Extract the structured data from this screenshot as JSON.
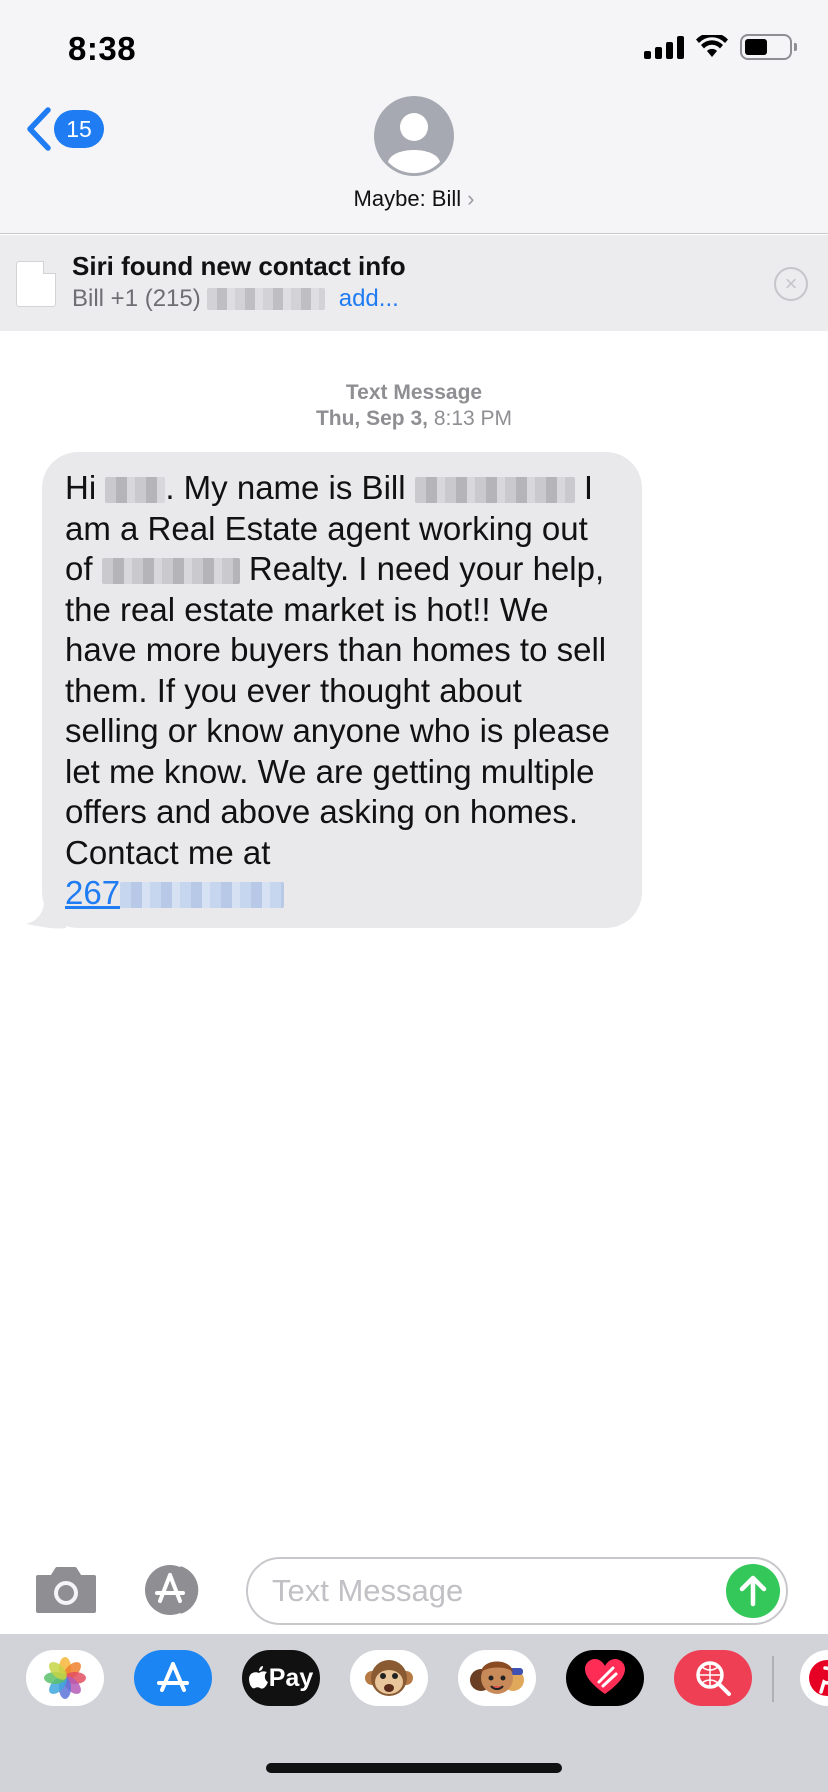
{
  "status_bar": {
    "time": "8:38"
  },
  "nav": {
    "back_badge": "15",
    "contact_name": "Maybe: Bill",
    "contact_chevron": "›"
  },
  "siri_banner": {
    "title": "Siri found new contact info",
    "detail_prefix": "Bill +1 (215)",
    "add_label": "add..."
  },
  "conversation": {
    "service": "Text Message",
    "date": "Thu, Sep 3,",
    "time": "8:13 PM",
    "message": {
      "part1": "Hi",
      "part2": ". My name is Bill",
      "part3": "I am a Real Estate agent working out of",
      "part4": "Realty. I need your help, the real estate market is hot!! We have more buyers than homes to sell them. If you ever thought about selling or know anyone who is please let me know. We are getting multiple offers and above asking on homes. Contact me at",
      "phone_visible": "267"
    }
  },
  "composer": {
    "placeholder": "Text Message"
  },
  "app_drawer": {
    "apps": [
      "photos-icon",
      "app-store-icon",
      "apple-pay-icon",
      "animoji-icon",
      "memoji-icon",
      "digital-touch-icon",
      "web-search-icon",
      "pinterest-icon"
    ],
    "apple_pay_label": "Pay",
    "apple_pay_logo": ""
  },
  "colors": {
    "accent": "#1f7cf2",
    "bubble": "#e9e9eb",
    "send": "#34c759"
  }
}
